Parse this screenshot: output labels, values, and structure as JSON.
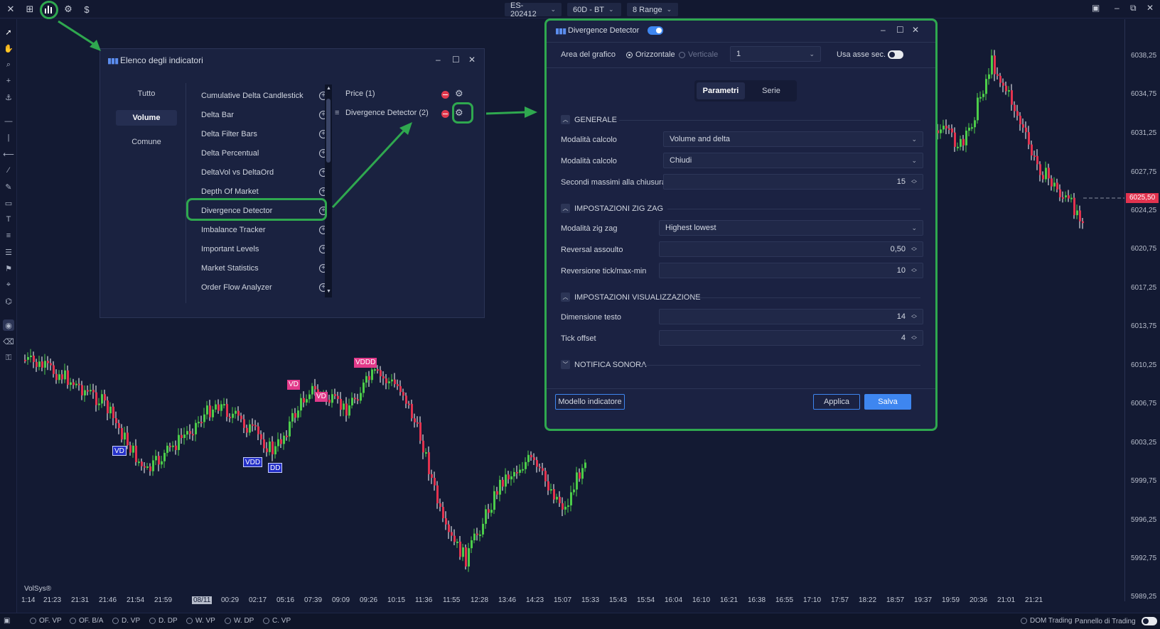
{
  "toolbar": {
    "symbol": "ES-202412",
    "timeframe": "60D - BT",
    "range": "8 Range"
  },
  "price_axis": {
    "labels": [
      "6038,25",
      "6034,75",
      "6031,25",
      "6027,75",
      "6024,25",
      "6020,75",
      "6017,25",
      "6013,75",
      "6010,25",
      "6006,75",
      "6003,25",
      "5999,75",
      "5996,25",
      "5992,75",
      "5989,25"
    ],
    "current_price": "6025,50"
  },
  "time_axis": {
    "labels": [
      "1:14",
      "21:23",
      "21:31",
      "21:46",
      "21:54",
      "21:59",
      "08/11",
      "00:29",
      "02:17",
      "05:16",
      "07:39",
      "09:09",
      "09:26",
      "10:15",
      "11:36",
      "11:55",
      "12:28",
      "13:46",
      "14:23",
      "15:07",
      "15:33",
      "15:43",
      "15:54",
      "16:04",
      "16:10",
      "16:21",
      "16:38",
      "16:55",
      "17:10",
      "17:57",
      "18:22",
      "18:57",
      "19:37",
      "19:59",
      "20:36",
      "21:01",
      "21:21"
    ]
  },
  "watermark": "VolSys®",
  "bottom_bar": {
    "items": [
      "OF. VP",
      "OF. B/A",
      "D. VP",
      "D. DP",
      "W. VP",
      "W. DP",
      "C. VP"
    ],
    "dom_trading": "DOM Trading",
    "trading_panel": "Pannello di Trading"
  },
  "markers": {
    "vd": "VD",
    "vdd": "VDD",
    "dd": "DD",
    "vddd": "VDDD"
  },
  "indicator_list": {
    "title": "Elenco degli indicatori",
    "categories": [
      "Tutto",
      "Volume",
      "Comune"
    ],
    "active_category": "Volume",
    "items": [
      "Cumulative Delta Candlestick",
      "Delta Bar",
      "Delta Filter Bars",
      "Delta Percentual",
      "DeltaVol vs DeltaOrd",
      "Depth Of Market",
      "Divergence Detector",
      "Imbalance Tracker",
      "Important Levels",
      "Market Statistics",
      "Order Flow Analyzer"
    ],
    "applied": [
      "Price (1)",
      "Divergence Detector (2)"
    ]
  },
  "settings": {
    "title": "Divergence Detector",
    "area_label": "Area del grafico",
    "orient_h": "Orizzontale",
    "orient_v": "Verticale",
    "area_value": "1",
    "sec_axis": "Usa asse sec.",
    "tabs": [
      "Parametri",
      "Serie"
    ],
    "sections": {
      "general": "GENERALE",
      "zigzag": "IMPOSTAZIONI ZIG ZAG",
      "display": "IMPOSTAZIONI VISUALIZZAZIONE",
      "sound": "NOTIFICA SONORA"
    },
    "fields": {
      "calc_mode_1_label": "Modalità calcolo",
      "calc_mode_1_value": "Volume and delta",
      "calc_mode_2_label": "Modalità calcolo",
      "calc_mode_2_value": "Chiudi",
      "max_seconds_label": "Secondi massimi alla chiusura",
      "max_seconds_value": "15",
      "zigzag_mode_label": "Modalità zig zag",
      "zigzag_mode_value": "Highest lowest",
      "reversal_abs_label": "Reversal assoulto",
      "reversal_abs_value": "0,50",
      "reversal_tick_label": "Reversione tick/max-min",
      "reversal_tick_value": "10",
      "text_size_label": "Dimensione testo",
      "text_size_value": "14",
      "tick_offset_label": "Tick offset",
      "tick_offset_value": "4"
    },
    "buttons": {
      "template": "Modello indicatore",
      "apply": "Applica",
      "save": "Salva"
    }
  },
  "colors": {
    "up": "#4ccd4a",
    "down": "#e2334f",
    "accent": "#3e86f0",
    "highlight": "#2fa84f"
  }
}
